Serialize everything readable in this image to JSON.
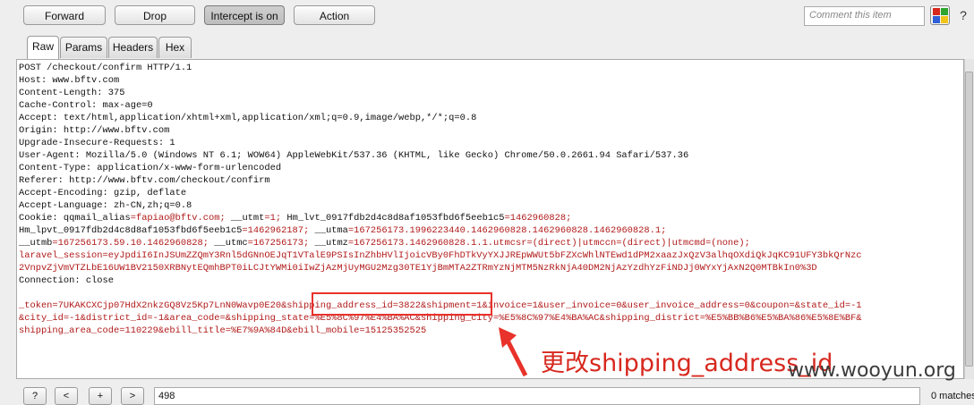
{
  "toolbar": {
    "forward": "Forward",
    "drop": "Drop",
    "intercept": "Intercept is on",
    "action": "Action",
    "comment_placeholder": "Comment this item",
    "more": "?"
  },
  "colors": {
    "red": "#d7281e",
    "green": "#2ea52e",
    "blue": "#2f5fd6",
    "yellow": "#f0c419",
    "accent_text": "#b11a1a"
  },
  "tabs": [
    "Raw",
    "Params",
    "Headers",
    "Hex"
  ],
  "request": {
    "lines": [
      {
        "text": "POST /checkout/confirm HTTP/1.1",
        "color": "black"
      },
      {
        "text": "Host: www.bftv.com",
        "color": "black"
      },
      {
        "text": "Content-Length: 375",
        "color": "black"
      },
      {
        "text": "Cache-Control: max-age=0",
        "color": "black"
      },
      {
        "text": "Accept: text/html,application/xhtml+xml,application/xml;q=0.9,image/webp,*/*;q=0.8",
        "color": "black"
      },
      {
        "text": "Origin: http://www.bftv.com",
        "color": "black"
      },
      {
        "text": "Upgrade-Insecure-Requests: 1",
        "color": "black"
      },
      {
        "text": "User-Agent: Mozilla/5.0 (Windows NT 6.1; WOW64) AppleWebKit/537.36 (KHTML, like Gecko) Chrome/50.0.2661.94 Safari/537.36",
        "color": "black"
      },
      {
        "text": "Content-Type: application/x-www-form-urlencoded",
        "color": "black"
      },
      {
        "text": "Referer: http://www.bftv.com/checkout/confirm",
        "color": "black"
      },
      {
        "text": "Accept-Encoding: gzip, deflate",
        "color": "black"
      },
      {
        "text": "Accept-Language: zh-CN,zh;q=0.8",
        "color": "black"
      },
      {
        "text": "Cookie: qqmail_alias=fapiao@bftv.com; __utmt=1; Hm_lvt_0917fdb2d4c8d8af1053fbd6f5eeb1c5=1462960828;",
        "color": "mixed"
      },
      {
        "text": "Hm_lpvt_0917fdb2d4c8d8af1053fbd6f5eeb1c5=1462962187; __utma=167256173.1996223440.1462960828.1462960828.1462960828.1;",
        "color": "mixed"
      },
      {
        "text": "__utmb=167256173.59.10.1462960828; __utmc=167256173; __utmz=167256173.1462960828.1.1.utmcsr=(direct)|utmccn=(direct)|utmcmd=(none);",
        "color": "mixed"
      },
      {
        "text": "laravel_session=eyJpdiI6InJSUmZZQmY3Rnl5dGNnOEJqT1VTalE9PSIsInZhbHVlIjoicVBy0FhDTkVyYXJJREpWWUt5bFZXcWhlNTEwd1dPM2xaazJxQzV3alhqOXdiQkJqKC91UFY3bkQrNzc2VnpvZjVmVTZLbE16UW1BV2150XRBNytEQmhBPT0iLCJtYWMi0iIwZjAzMjUyMGU2Mzg30TE1YjBmMTA2ZTRmYzNjMTM5NzRkNjA40DM2NjAzYzdhYzFiNDJj0WYxYjAxN2Q0MTBkIn0%3D",
        "color": "red",
        "wrap": 2
      },
      {
        "text": "Connection: close",
        "color": "black"
      },
      {
        "text": "",
        "color": "black"
      },
      {
        "text": "_token=7UKAKCXCjp07HdX2nkzGQ8Vz5Kp7LnN0Wavp0E20&shipping_address_id=3822&shipment=1&invoice=1&user_invoice=0&user_invoice_address=0&coupon=&state_id=-1&city_id=-1&district_id=-1&area_code=&shipping_state=%E5%8C%97%E4%BA%AC&shipping_city=%E5%8C%97%E4%BA%AC&shipping_district=%E5%BB%B6%E5%BA%86%E5%8E%BF&shipping_area_code=110229&ebill_title=%E7%9A%84D&ebill_mobile=15125352525",
        "color": "red",
        "wrap": 3
      }
    ]
  },
  "annotation": {
    "label": "更改shipping_address_id"
  },
  "watermark": "www.wooyun.org",
  "bottom": {
    "help": "?",
    "prev": "<",
    "add": "+",
    "next": ">",
    "search_value": "498",
    "matches": "0 matches"
  }
}
